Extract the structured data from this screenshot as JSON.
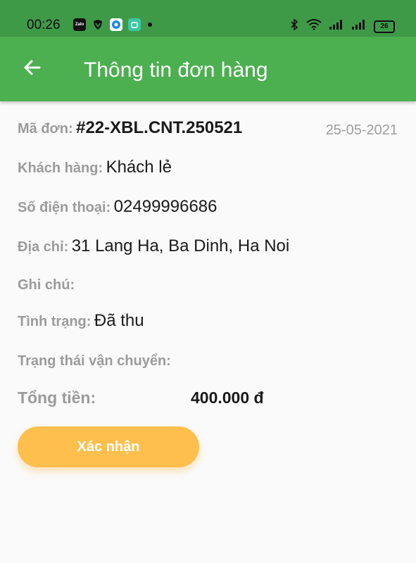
{
  "status_bar": {
    "time": "00:26",
    "battery": "26",
    "app_icons": [
      "zalo-icon",
      "shield-icon",
      "browser-icon",
      "app-icon"
    ],
    "right_icons": [
      "bluetooth-icon",
      "wifi-icon",
      "signal-icon",
      "signal-icon",
      "battery-icon"
    ]
  },
  "app_bar": {
    "title": "Thông tin đơn hàng",
    "back_icon": "arrow-left-icon"
  },
  "order": {
    "code_label": "Mã đơn:",
    "code_value": "#22-XBL.CNT.250521",
    "date": "25-05-2021",
    "customer_label": "Khách hàng:",
    "customer_value": "Khách lẻ",
    "phone_label": "Số điện thoại:",
    "phone_value": "02499996686",
    "address_label": "Địa chỉ:",
    "address_value": "31 Lang Ha, Ba Dinh, Ha Noi",
    "note_label": "Ghi chú:",
    "status_label": "Tình trạng:",
    "status_value": "Đã thu",
    "shipping_label": "Trạng thái vận chuyển:",
    "total_label": "Tổng tiền:",
    "total_value": "400.000 đ"
  },
  "actions": {
    "confirm_label": "Xác nhận"
  },
  "colors": {
    "status_bar": "#3f9a48",
    "app_bar": "#4caf50",
    "button": "#ffbf4d",
    "label": "#9b9b9b"
  }
}
